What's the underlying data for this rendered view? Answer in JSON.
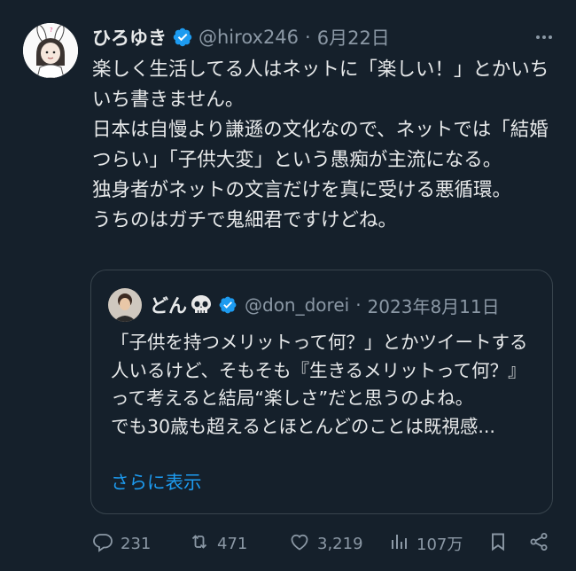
{
  "tweet": {
    "display_name": "ひろゆき",
    "handle": "@hirox246",
    "separator": "·",
    "date": "6月22日",
    "text": "楽しく生活してる人はネットに「楽しい！」とかいちいち書きません。\n日本は自慢より謙遜の文化なので、ネットでは「結婚つらい」「子供大変」という愚痴が主流になる。\n独身者がネットの文言だけを真に受ける悪循環。\nうちのはガチで鬼細君ですけどね。"
  },
  "quote": {
    "display_name": "どん",
    "handle": "@don_dorei",
    "separator": "·",
    "date": "2023年8月11日",
    "text": "「子供を持つメリットって何？」とかツイートする人いるけど、そもそも『生きるメリットって何？』って考えると結局“楽しさ”だと思うのよね。\nでも30歳も超えるとほとんどのことは既視感...",
    "show_more": "さらに表示"
  },
  "actions": {
    "replies": "231",
    "retweets": "471",
    "likes": "3,219",
    "views": "107万"
  },
  "colors": {
    "background": "#15202b",
    "text": "#e7e9ea",
    "secondary": "#8b98a5",
    "accent": "#1d9bf0",
    "border": "#38444d"
  },
  "icons": [
    "more-icon",
    "verified-badge-icon",
    "skull-emoji-icon",
    "reply-icon",
    "retweet-icon",
    "like-icon",
    "views-icon",
    "bookmark-icon",
    "share-icon"
  ]
}
